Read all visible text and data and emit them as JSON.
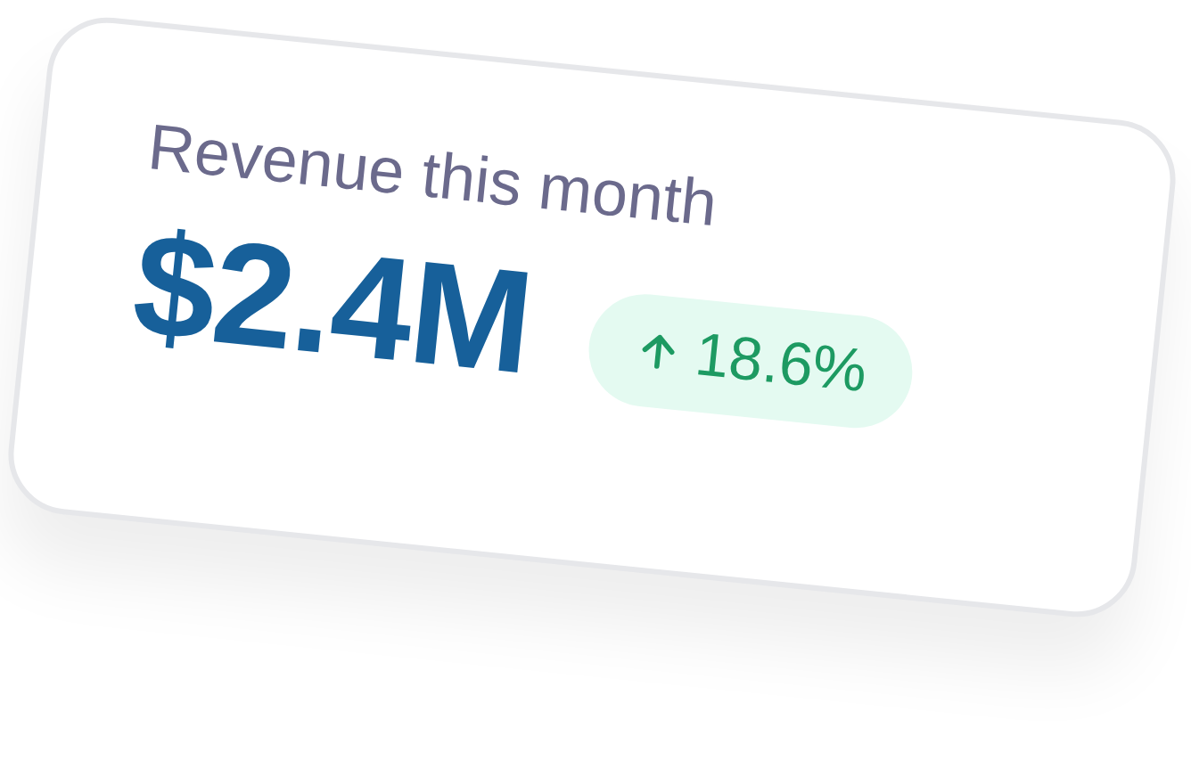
{
  "card": {
    "label": "Revenue this month",
    "value": "$2.4M",
    "change": {
      "increase": true,
      "text": "18.6%"
    }
  }
}
